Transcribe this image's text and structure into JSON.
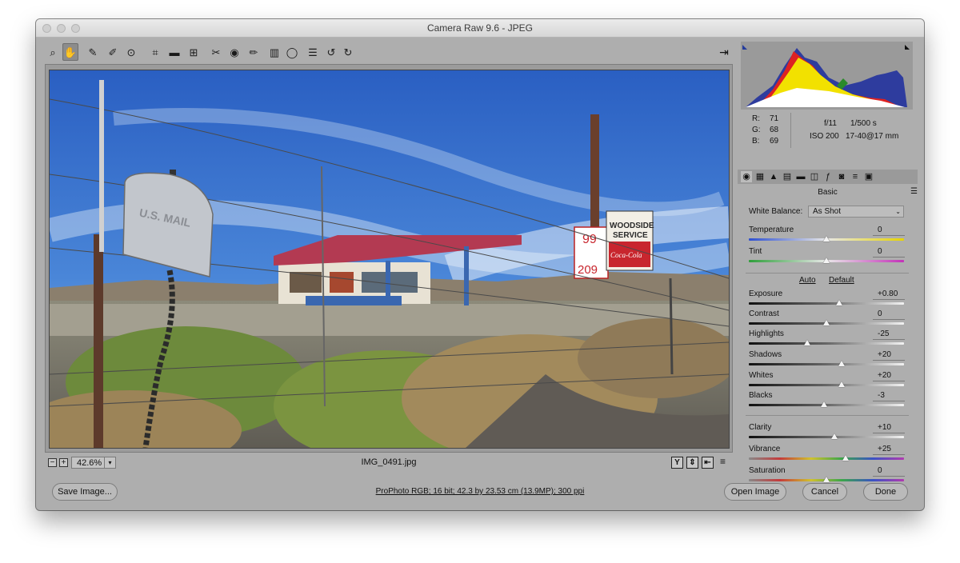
{
  "window": {
    "title": "Camera Raw 9.6  -  JPEG"
  },
  "toolbar": {
    "tools": [
      {
        "name": "zoom-tool-icon",
        "glyph": "⌕"
      },
      {
        "name": "hand-tool-icon",
        "glyph": "✋"
      },
      {
        "name": "white-balance-tool-icon",
        "glyph": "✎"
      },
      {
        "name": "color-sampler-tool-icon",
        "glyph": "✐"
      },
      {
        "name": "targeted-adjustment-tool-icon",
        "glyph": "⊙"
      },
      {
        "name": "crop-tool-icon",
        "glyph": "⌗"
      },
      {
        "name": "straighten-tool-icon",
        "glyph": "▬"
      },
      {
        "name": "transform-tool-icon",
        "glyph": "⊞"
      },
      {
        "name": "spot-removal-tool-icon",
        "glyph": "✂"
      },
      {
        "name": "red-eye-tool-icon",
        "glyph": "◉"
      },
      {
        "name": "adjustment-brush-icon",
        "glyph": "✏"
      },
      {
        "name": "graduated-filter-icon",
        "glyph": "▥"
      },
      {
        "name": "radial-filter-icon",
        "glyph": "◯"
      },
      {
        "name": "preferences-icon",
        "glyph": "☰"
      },
      {
        "name": "rotate-left-icon",
        "glyph": "↺"
      },
      {
        "name": "rotate-right-icon",
        "glyph": "↻"
      }
    ],
    "preview_glyph": "⇥"
  },
  "status": {
    "zoom_out": "−",
    "zoom_in": "+",
    "zoom": "42.6%",
    "filename": "IMG_0491.jpg",
    "before_after_glyph": "Y"
  },
  "info": {
    "r_label": "R:",
    "r": "71",
    "g_label": "G:",
    "g": "68",
    "b_label": "B:",
    "b": "69",
    "aperture": "f/11",
    "shutter": "1/500 s",
    "iso": "ISO 200",
    "lens": "17-40@17 mm"
  },
  "panel": {
    "section_title": "Basic",
    "white_balance_label": "White Balance:",
    "white_balance_value": "As Shot",
    "auto_label": "Auto",
    "default_label": "Default",
    "sliders": [
      {
        "id": "temperature",
        "label": "Temperature",
        "value": "0",
        "position": 0.5,
        "track": "temp"
      },
      {
        "id": "tint",
        "label": "Tint",
        "value": "0",
        "position": 0.5,
        "track": "tint"
      },
      {
        "id": "exposure",
        "label": "Exposure",
        "value": "+0.80",
        "position": 0.58,
        "track": "gray"
      },
      {
        "id": "contrast",
        "label": "Contrast",
        "value": "0",
        "position": 0.5,
        "track": "gray"
      },
      {
        "id": "highlights",
        "label": "Highlights",
        "value": "-25",
        "position": 0.375,
        "track": "gray"
      },
      {
        "id": "shadows",
        "label": "Shadows",
        "value": "+20",
        "position": 0.6,
        "track": "gray"
      },
      {
        "id": "whites",
        "label": "Whites",
        "value": "+20",
        "position": 0.6,
        "track": "gray"
      },
      {
        "id": "blacks",
        "label": "Blacks",
        "value": "-3",
        "position": 0.485,
        "track": "gray"
      },
      {
        "id": "clarity",
        "label": "Clarity",
        "value": "+10",
        "position": 0.55,
        "track": "gray"
      },
      {
        "id": "vibrance",
        "label": "Vibrance",
        "value": "+25",
        "position": 0.625,
        "track": "color"
      },
      {
        "id": "saturation",
        "label": "Saturation",
        "value": "0",
        "position": 0.5,
        "track": "color"
      }
    ]
  },
  "bottom": {
    "save_label": "Save Image...",
    "workflow_options": "ProPhoto RGB; 16 bit; 42.3 by 23.53 cm (13.9MP); 300 ppi",
    "open_label": "Open Image",
    "cancel_label": "Cancel",
    "done_label": "Done"
  },
  "photo_signs": {
    "mailbox_text": "U.S. MAIL",
    "service_sign_1": "WOODSIDE",
    "service_sign_2": "SERVICE",
    "cola_text": "Coca-Cola",
    "price_1": "99",
    "price_2": "209"
  },
  "colors": {
    "window_bg": "#aeaeae",
    "sky": "#2f66c8",
    "accent_red": "#c8262e"
  }
}
